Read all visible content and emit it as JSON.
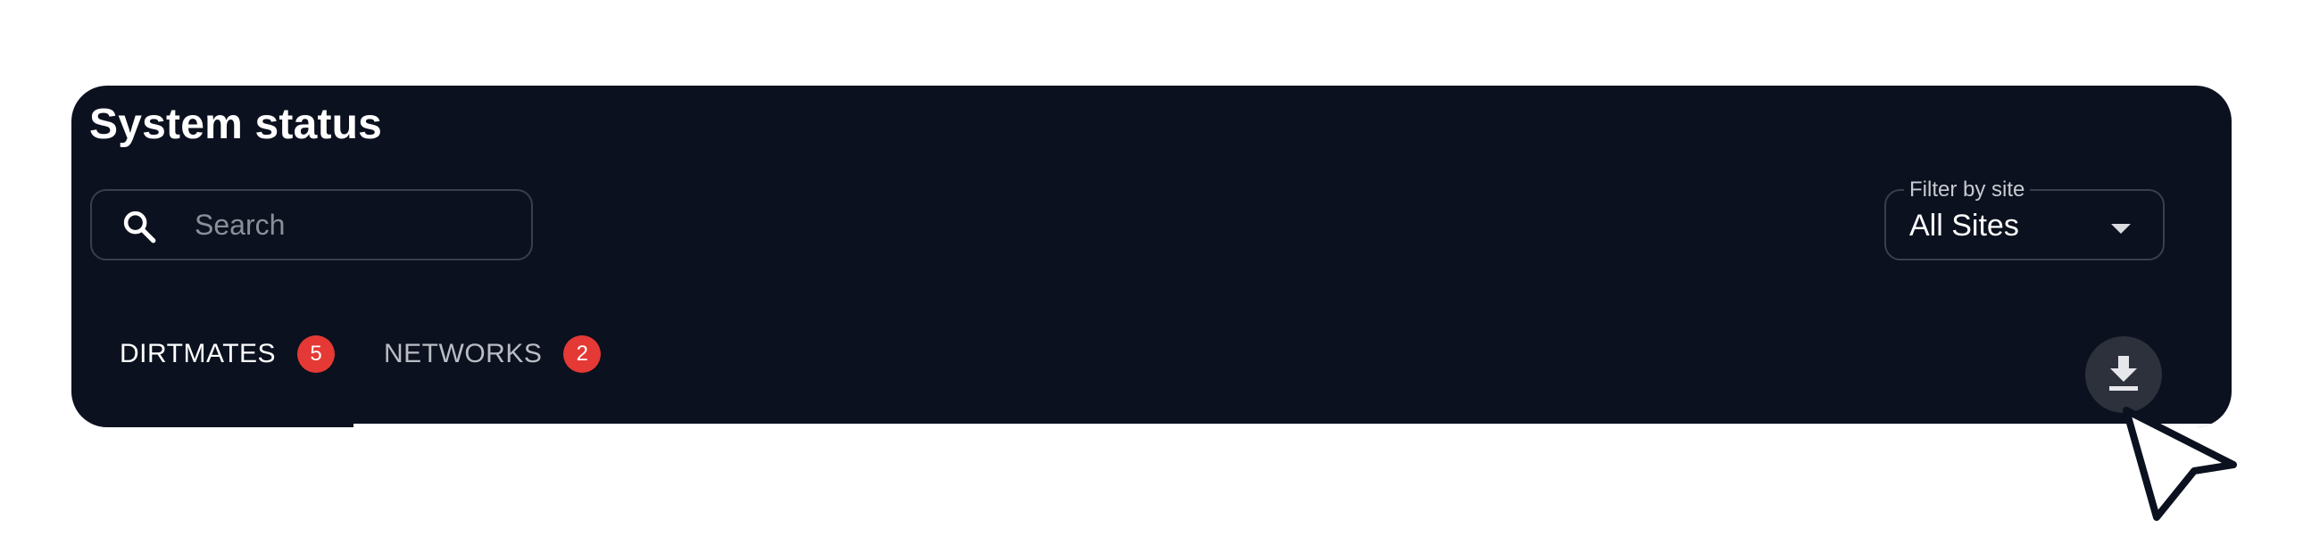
{
  "header": {
    "title": "System status"
  },
  "search": {
    "placeholder": "Search",
    "icon": "search-icon"
  },
  "filter": {
    "label": "Filter by site",
    "value": "All Sites",
    "icon": "chevron-down-icon"
  },
  "tabs": [
    {
      "label": "DIRTMATES",
      "count": "5",
      "active": true
    },
    {
      "label": "NETWORKS",
      "count": "2",
      "active": false
    }
  ],
  "actions": {
    "download_icon": "download-icon"
  },
  "colors": {
    "panel_background": "#0b111e",
    "badge": "#e53935",
    "border": "#3a3f4b"
  }
}
